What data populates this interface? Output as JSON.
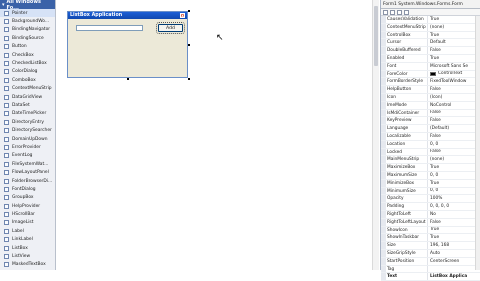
{
  "toolbox": {
    "header": "All Windows Fo...",
    "items": [
      "Pointer",
      "BackgroundWo...",
      "BindingNavigator",
      "BindingSource",
      "Button",
      "CheckBox",
      "CheckedListBox",
      "ColorDialog",
      "ComboBox",
      "ContextMenuStrip",
      "DataGridView",
      "DataSet",
      "DateTimePicker",
      "DirectoryEntry",
      "DirectorySearcher",
      "DomainUpDown",
      "ErrorProvider",
      "EventLog",
      "FileSystemWat...",
      "FlowLayoutPanel",
      "FolderBrowserDi...",
      "FontDialog",
      "GroupBox",
      "HelpProvider",
      "HScrollBar",
      "ImageList",
      "Label",
      "LinkLabel",
      "ListBox",
      "ListView",
      "MaskedTextBox"
    ]
  },
  "form": {
    "title": "ListBox Application",
    "close_glyph": "x",
    "add_button": "Add"
  },
  "properties": {
    "selector": "Form1 System.Windows.Forms.Form",
    "rows": [
      {
        "name": "CausesValidation",
        "value": "True"
      },
      {
        "name": "ContextMenuStrip",
        "value": "(none)"
      },
      {
        "name": "ControlBox",
        "value": "True"
      },
      {
        "name": "Cursor",
        "value": "Default"
      },
      {
        "name": "DoubleBuffered",
        "value": "False"
      },
      {
        "name": "Enabled",
        "value": "True"
      },
      {
        "name": "Font",
        "value": "Microsoft Sans Se"
      },
      {
        "name": "ForeColor",
        "value": "ControlText",
        "swatch": "#000000"
      },
      {
        "name": "FormBorderStyle",
        "value": "FixedToolWindow"
      },
      {
        "name": "HelpButton",
        "value": "False"
      },
      {
        "name": "Icon",
        "value": "(Icon)"
      },
      {
        "name": "ImeMode",
        "value": "NoControl"
      },
      {
        "name": "IsMdiContainer",
        "value": "False"
      },
      {
        "name": "KeyPreview",
        "value": "False"
      },
      {
        "name": "Language",
        "value": "(Default)"
      },
      {
        "name": "Localizable",
        "value": "False"
      },
      {
        "name": "Location",
        "value": "0, 0"
      },
      {
        "name": "Locked",
        "value": "False"
      },
      {
        "name": "MainMenuStrip",
        "value": "(none)"
      },
      {
        "name": "MaximizeBox",
        "value": "True"
      },
      {
        "name": "MaximumSize",
        "value": "0, 0"
      },
      {
        "name": "MinimizeBox",
        "value": "True"
      },
      {
        "name": "MinimumSize",
        "value": "0, 0"
      },
      {
        "name": "Opacity",
        "value": "100%"
      },
      {
        "name": "Padding",
        "value": "0, 0, 0, 0"
      },
      {
        "name": "RightToLeft",
        "value": "No"
      },
      {
        "name": "RightToLeftLayout",
        "value": "False"
      },
      {
        "name": "ShowIcon",
        "value": "True"
      },
      {
        "name": "ShowInTaskbar",
        "value": "True"
      },
      {
        "name": "Size",
        "value": "196, 168"
      },
      {
        "name": "SizeGripStyle",
        "value": "Auto"
      },
      {
        "name": "StartPosition",
        "value": "CenterScreen"
      },
      {
        "name": "Tag",
        "value": ""
      },
      {
        "name": "Text",
        "value": "ListBox Applica",
        "selected": true
      }
    ]
  }
}
